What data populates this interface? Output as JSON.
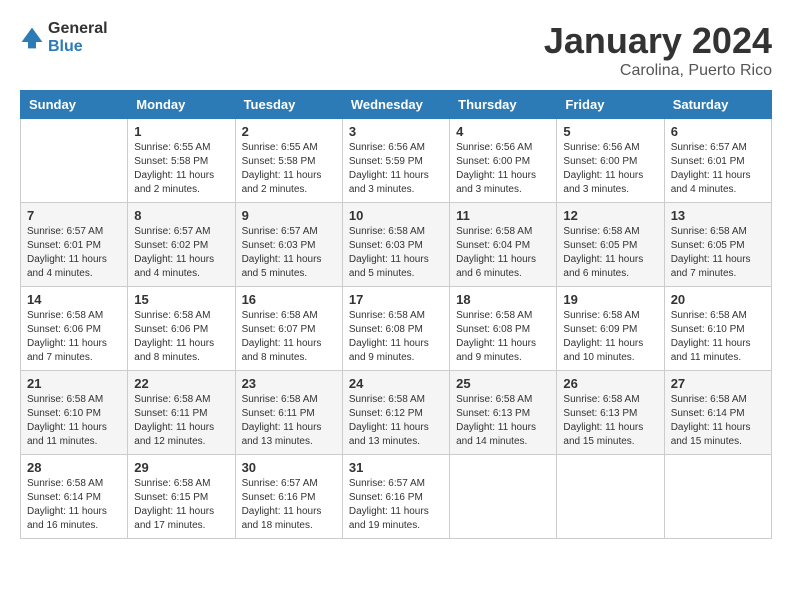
{
  "header": {
    "logo_general": "General",
    "logo_blue": "Blue",
    "title": "January 2024",
    "subtitle": "Carolina, Puerto Rico"
  },
  "columns": [
    "Sunday",
    "Monday",
    "Tuesday",
    "Wednesday",
    "Thursday",
    "Friday",
    "Saturday"
  ],
  "weeks": [
    [
      {
        "day": "",
        "info": ""
      },
      {
        "day": "1",
        "info": "Sunrise: 6:55 AM\nSunset: 5:58 PM\nDaylight: 11 hours\nand 2 minutes."
      },
      {
        "day": "2",
        "info": "Sunrise: 6:55 AM\nSunset: 5:58 PM\nDaylight: 11 hours\nand 2 minutes."
      },
      {
        "day": "3",
        "info": "Sunrise: 6:56 AM\nSunset: 5:59 PM\nDaylight: 11 hours\nand 3 minutes."
      },
      {
        "day": "4",
        "info": "Sunrise: 6:56 AM\nSunset: 6:00 PM\nDaylight: 11 hours\nand 3 minutes."
      },
      {
        "day": "5",
        "info": "Sunrise: 6:56 AM\nSunset: 6:00 PM\nDaylight: 11 hours\nand 3 minutes."
      },
      {
        "day": "6",
        "info": "Sunrise: 6:57 AM\nSunset: 6:01 PM\nDaylight: 11 hours\nand 4 minutes."
      }
    ],
    [
      {
        "day": "7",
        "info": "Sunrise: 6:57 AM\nSunset: 6:01 PM\nDaylight: 11 hours\nand 4 minutes."
      },
      {
        "day": "8",
        "info": "Sunrise: 6:57 AM\nSunset: 6:02 PM\nDaylight: 11 hours\nand 4 minutes."
      },
      {
        "day": "9",
        "info": "Sunrise: 6:57 AM\nSunset: 6:03 PM\nDaylight: 11 hours\nand 5 minutes."
      },
      {
        "day": "10",
        "info": "Sunrise: 6:58 AM\nSunset: 6:03 PM\nDaylight: 11 hours\nand 5 minutes."
      },
      {
        "day": "11",
        "info": "Sunrise: 6:58 AM\nSunset: 6:04 PM\nDaylight: 11 hours\nand 6 minutes."
      },
      {
        "day": "12",
        "info": "Sunrise: 6:58 AM\nSunset: 6:05 PM\nDaylight: 11 hours\nand 6 minutes."
      },
      {
        "day": "13",
        "info": "Sunrise: 6:58 AM\nSunset: 6:05 PM\nDaylight: 11 hours\nand 7 minutes."
      }
    ],
    [
      {
        "day": "14",
        "info": "Sunrise: 6:58 AM\nSunset: 6:06 PM\nDaylight: 11 hours\nand 7 minutes."
      },
      {
        "day": "15",
        "info": "Sunrise: 6:58 AM\nSunset: 6:06 PM\nDaylight: 11 hours\nand 8 minutes."
      },
      {
        "day": "16",
        "info": "Sunrise: 6:58 AM\nSunset: 6:07 PM\nDaylight: 11 hours\nand 8 minutes."
      },
      {
        "day": "17",
        "info": "Sunrise: 6:58 AM\nSunset: 6:08 PM\nDaylight: 11 hours\nand 9 minutes."
      },
      {
        "day": "18",
        "info": "Sunrise: 6:58 AM\nSunset: 6:08 PM\nDaylight: 11 hours\nand 9 minutes."
      },
      {
        "day": "19",
        "info": "Sunrise: 6:58 AM\nSunset: 6:09 PM\nDaylight: 11 hours\nand 10 minutes."
      },
      {
        "day": "20",
        "info": "Sunrise: 6:58 AM\nSunset: 6:10 PM\nDaylight: 11 hours\nand 11 minutes."
      }
    ],
    [
      {
        "day": "21",
        "info": "Sunrise: 6:58 AM\nSunset: 6:10 PM\nDaylight: 11 hours\nand 11 minutes."
      },
      {
        "day": "22",
        "info": "Sunrise: 6:58 AM\nSunset: 6:11 PM\nDaylight: 11 hours\nand 12 minutes."
      },
      {
        "day": "23",
        "info": "Sunrise: 6:58 AM\nSunset: 6:11 PM\nDaylight: 11 hours\nand 13 minutes."
      },
      {
        "day": "24",
        "info": "Sunrise: 6:58 AM\nSunset: 6:12 PM\nDaylight: 11 hours\nand 13 minutes."
      },
      {
        "day": "25",
        "info": "Sunrise: 6:58 AM\nSunset: 6:13 PM\nDaylight: 11 hours\nand 14 minutes."
      },
      {
        "day": "26",
        "info": "Sunrise: 6:58 AM\nSunset: 6:13 PM\nDaylight: 11 hours\nand 15 minutes."
      },
      {
        "day": "27",
        "info": "Sunrise: 6:58 AM\nSunset: 6:14 PM\nDaylight: 11 hours\nand 15 minutes."
      }
    ],
    [
      {
        "day": "28",
        "info": "Sunrise: 6:58 AM\nSunset: 6:14 PM\nDaylight: 11 hours\nand 16 minutes."
      },
      {
        "day": "29",
        "info": "Sunrise: 6:58 AM\nSunset: 6:15 PM\nDaylight: 11 hours\nand 17 minutes."
      },
      {
        "day": "30",
        "info": "Sunrise: 6:57 AM\nSunset: 6:16 PM\nDaylight: 11 hours\nand 18 minutes."
      },
      {
        "day": "31",
        "info": "Sunrise: 6:57 AM\nSunset: 6:16 PM\nDaylight: 11 hours\nand 19 minutes."
      },
      {
        "day": "",
        "info": ""
      },
      {
        "day": "",
        "info": ""
      },
      {
        "day": "",
        "info": ""
      }
    ]
  ]
}
